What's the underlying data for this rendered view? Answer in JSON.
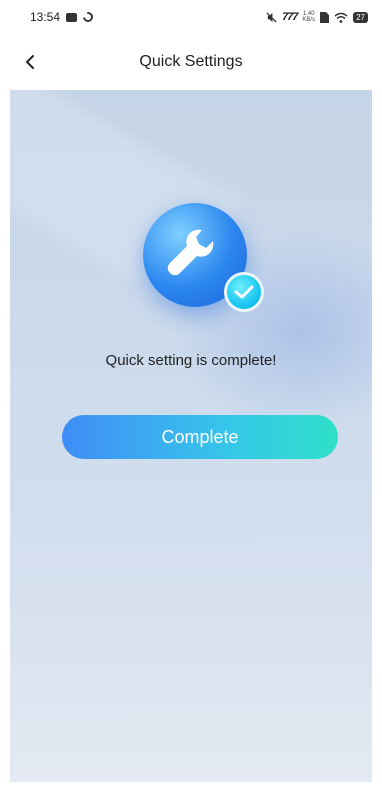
{
  "status_bar": {
    "time": "13:54",
    "signal_text": "777",
    "speed_top": "1.40",
    "speed_bottom": "KB/s",
    "battery": "27"
  },
  "header": {
    "title": "Quick Settings"
  },
  "main": {
    "message": "Quick setting is complete!",
    "complete_label": "Complete"
  },
  "icons": {
    "back": "chevron-left-icon",
    "hero": "wrench-icon",
    "badge": "check-icon"
  },
  "colors": {
    "button_gradient_start": "#3f8df7",
    "button_gradient_end": "#2fe0c9",
    "hero_blue": "#2a86ef",
    "badge_cyan": "#1cc7f0"
  }
}
